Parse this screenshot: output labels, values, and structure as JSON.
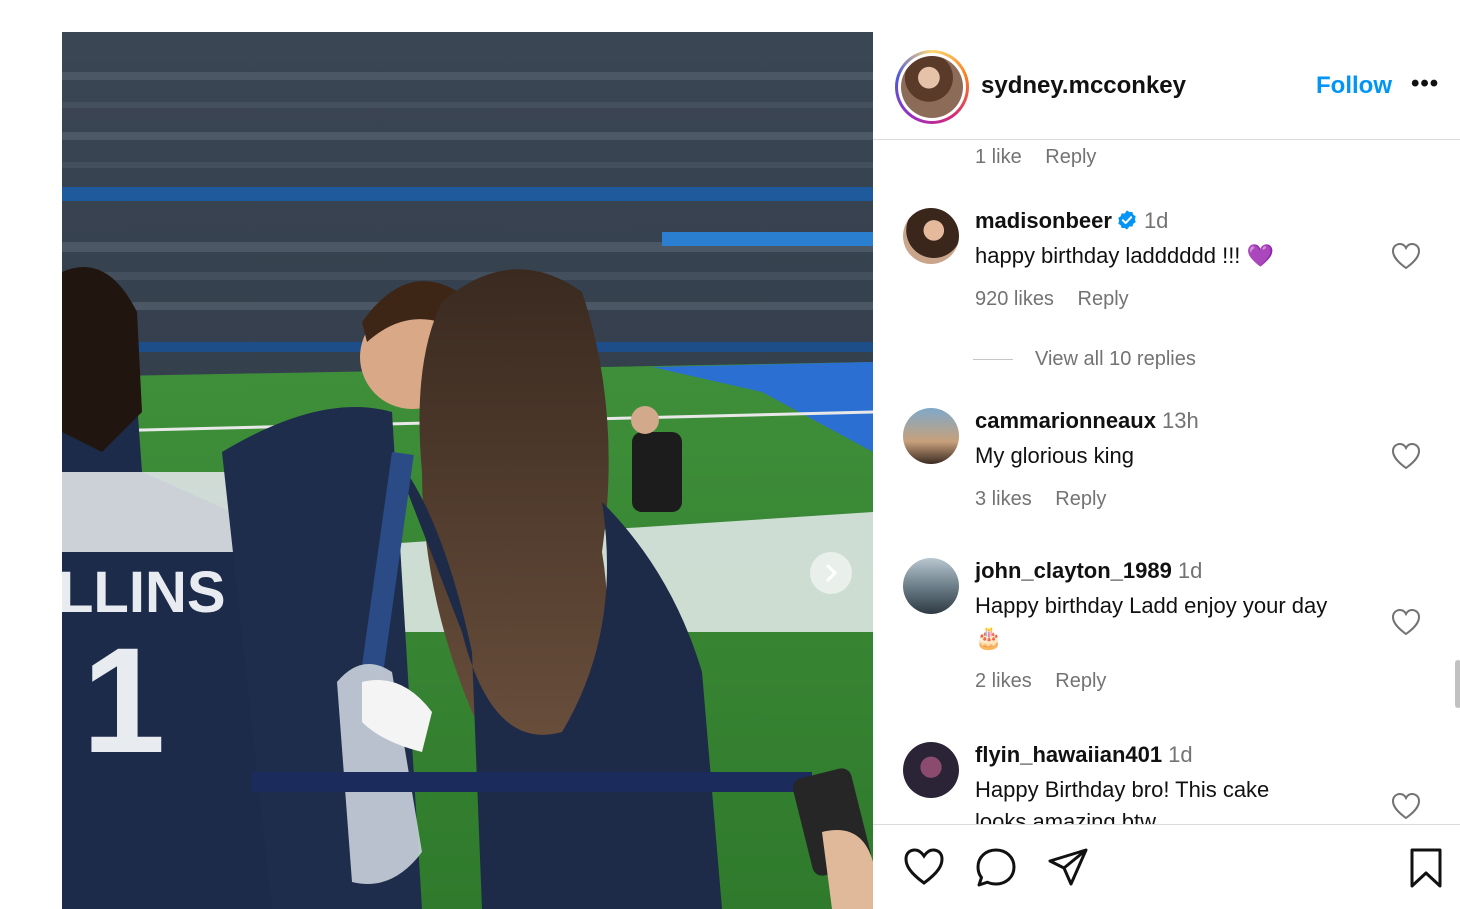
{
  "post": {
    "username": "sydney.mcconkey",
    "follow_label": "Follow",
    "more_label": "•••",
    "photo": {
      "jersey_text": "LLINS",
      "jersey_number": "1"
    }
  },
  "comments_top": {
    "likes": "1 like",
    "reply": "Reply"
  },
  "comments": [
    {
      "username": "madisonbeer",
      "time": "1d",
      "verified": true,
      "text": "happy birthday ladddddd !!! 💜",
      "likes": "920 likes",
      "reply": "Reply",
      "view_replies": "View all 10 replies"
    },
    {
      "username": "cammarionneaux",
      "time": "13h",
      "text": "My glorious king",
      "likes": "3 likes",
      "reply": "Reply"
    },
    {
      "username": "john_clayton_1989",
      "time": "1d",
      "text": "Happy birthday Ladd enjoy your day 🎂",
      "likes": "2 likes",
      "reply": "Reply"
    },
    {
      "username": "flyin_hawaiian401",
      "time": "1d",
      "text": "Happy Birthday bro! This cake looks amazing btw"
    }
  ],
  "icons": {
    "like": "heart-icon",
    "comment": "comment-icon",
    "share": "share-icon",
    "save": "bookmark-icon",
    "next": "chevron-right-icon",
    "more": "more-icon",
    "verified": "verified-badge-icon"
  },
  "colors": {
    "follow": "#0095f6",
    "verified": "#0095f6",
    "muted": "#737373"
  }
}
